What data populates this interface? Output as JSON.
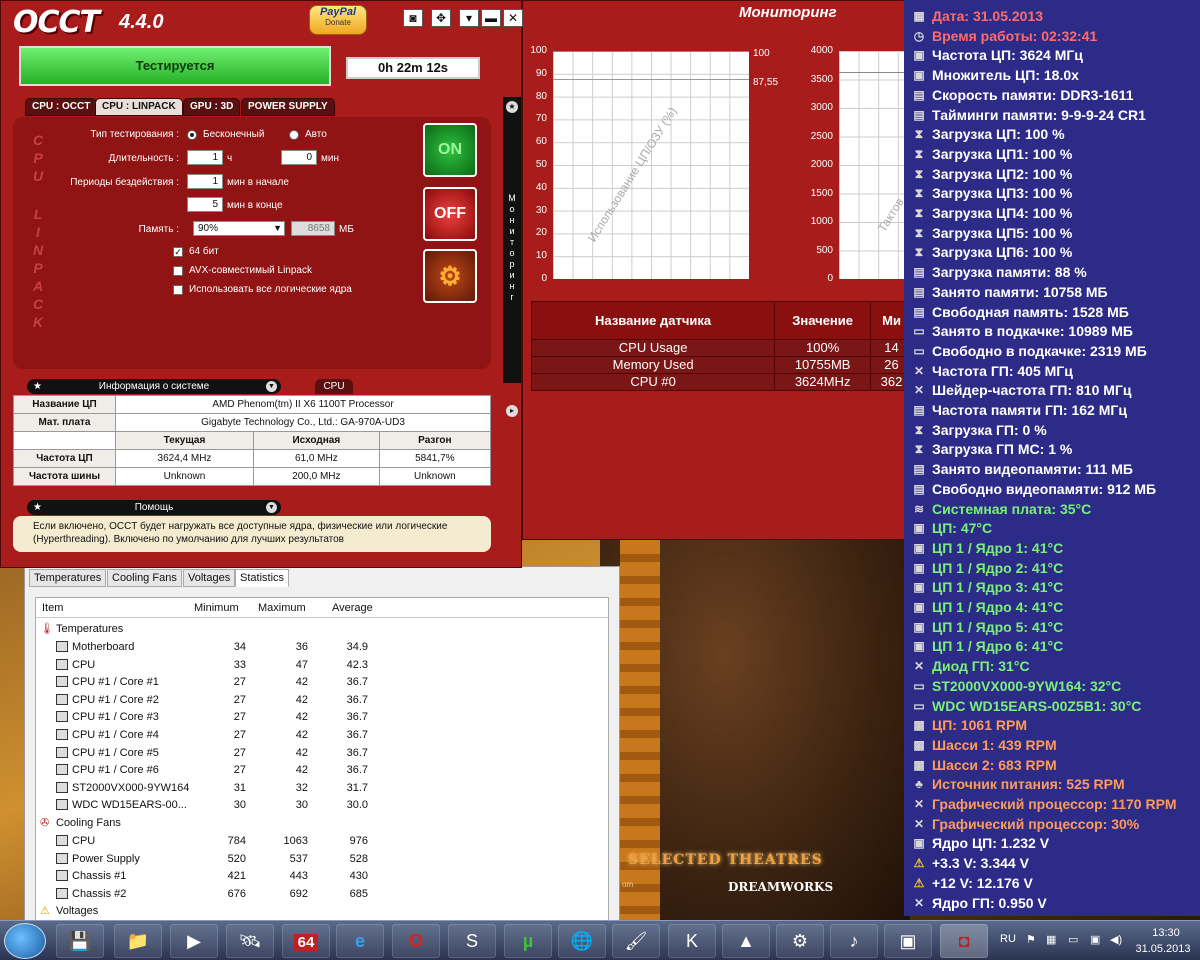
{
  "occt": {
    "logo": "OCCT",
    "version": "4.4.0",
    "paypal_label": "PayPal",
    "donate_label": "Donate",
    "status": "Тестируется",
    "timer": "0h 22m 12s",
    "tabs": [
      "CPU : OCCT",
      "CPU : LINPACK",
      "GPU : 3D",
      "POWER SUPPLY"
    ],
    "active_tab": 1,
    "vertical_label": "CPU LINPACK",
    "form": {
      "test_type_label": "Тип тестирования :",
      "test_type_infinite": "Бесконечный",
      "test_type_auto": "Авто",
      "duration_label": "Длительность :",
      "duration_hours": "1",
      "hours_unit": "ч",
      "duration_minutes": "0",
      "minutes_unit": "мин",
      "idle_label": "Периоды бездействия :",
      "idle_start": "1",
      "idle_start_unit": "мин в начале",
      "idle_end": "5",
      "idle_end_unit": "мин в конце",
      "memory_label": "Память :",
      "memory_value": "90%",
      "memory_mb": "8658",
      "memory_mb_unit": "МБ",
      "opt_64bit": "64 бит",
      "opt_avx": "AVX-совместимый Linpack",
      "opt_logical": "Использовать все логические ядра"
    },
    "on_label": "ON",
    "off_label": "OFF",
    "side_label": "Мониторинг",
    "sysinfo_header": "Информация о системе",
    "cpu_tab": "CPU",
    "sysinfo": {
      "cpu_name_label": "Название ЦП",
      "cpu_name": "AMD Phenom(tm) II X6 1100T Processor",
      "mobo_label": "Мат. плата",
      "mobo": "Gigabyte Technology Co., Ltd.: GA-970A-UD3",
      "col_current": "Текущая",
      "col_original": "Исходная",
      "col_overclock": "Разгон",
      "cpu_freq_label": "Частота ЦП",
      "cpu_freq_current": "3624,4 MHz",
      "cpu_freq_original": "61,0 MHz",
      "cpu_freq_overclock": "5841,7%",
      "bus_freq_label": "Частота шины",
      "bus_freq_current": "Unknown",
      "bus_freq_original": "200,0 MHz",
      "bus_freq_overclock": "Unknown"
    },
    "help_header": "Помощь",
    "help_text": "Если включено, OCCT будет нагружать все доступные ядра, физические или логические (Hyperthreading). Включено по умолчанию для лучших результатов"
  },
  "monitor": {
    "title": "Мониторинг",
    "chart1_label": "Использование ЦП/ОЗУ (%)",
    "chart1_ticks": [
      "100",
      "90",
      "80",
      "70",
      "60",
      "50",
      "40",
      "30",
      "20",
      "10",
      "0"
    ],
    "chart1_val_top": "100",
    "chart1_val_mid": "87,55",
    "chart2_label": "Тактов",
    "chart2_ticks": [
      "4000",
      "3500",
      "3000",
      "2500",
      "2000",
      "1500",
      "1000",
      "500",
      "0"
    ],
    "table_head": [
      "Название датчика",
      "Значение",
      "Ми"
    ],
    "rows": [
      {
        "name": "CPU Usage",
        "value": "100%",
        "min": "14"
      },
      {
        "name": "Memory Used",
        "value": "10755MB",
        "min": "26"
      },
      {
        "name": "CPU #0",
        "value": "3624MHz",
        "min": "362"
      }
    ]
  },
  "chart_data": [
    {
      "type": "line",
      "xlabel": "",
      "ylabel": "Использование ЦП/ОЗУ (%)",
      "ylim": [
        0,
        100
      ],
      "series": [
        {
          "name": "CPU Usage",
          "values": [
            100,
            100,
            100,
            100,
            100,
            100,
            100,
            100,
            100,
            100
          ]
        },
        {
          "name": "Memory Used",
          "values": [
            87.55,
            87.55,
            87.55,
            87.55,
            87.55,
            87.55,
            87.55,
            87.55,
            87.55,
            87.55
          ]
        }
      ]
    },
    {
      "type": "line",
      "xlabel": "",
      "ylabel": "Тактов",
      "ylim": [
        0,
        4000
      ],
      "series": [
        {
          "name": "CPU #0",
          "values": [
            3624,
            3624,
            3624,
            3624
          ]
        }
      ]
    }
  ],
  "stats": {
    "tabs": [
      "Temperatures",
      "Cooling Fans",
      "Voltages",
      "Statistics"
    ],
    "active_tab": 3,
    "headers": [
      "Item",
      "Minimum",
      "Maximum",
      "Average"
    ],
    "groups": [
      {
        "label": "Temperatures",
        "rows": [
          {
            "name": "Motherboard",
            "min": "34",
            "max": "36",
            "avg": "34.9"
          },
          {
            "name": "CPU",
            "min": "33",
            "max": "47",
            "avg": "42.3"
          },
          {
            "name": "CPU #1 / Core #1",
            "min": "27",
            "max": "42",
            "avg": "36.7"
          },
          {
            "name": "CPU #1 / Core #2",
            "min": "27",
            "max": "42",
            "avg": "36.7"
          },
          {
            "name": "CPU #1 / Core #3",
            "min": "27",
            "max": "42",
            "avg": "36.7"
          },
          {
            "name": "CPU #1 / Core #4",
            "min": "27",
            "max": "42",
            "avg": "36.7"
          },
          {
            "name": "CPU #1 / Core #5",
            "min": "27",
            "max": "42",
            "avg": "36.7"
          },
          {
            "name": "CPU #1 / Core #6",
            "min": "27",
            "max": "42",
            "avg": "36.7"
          },
          {
            "name": "ST2000VX000-9YW164",
            "min": "31",
            "max": "32",
            "avg": "31.7"
          },
          {
            "name": "WDC WD15EARS-00...",
            "min": "30",
            "max": "30",
            "avg": "30.0"
          }
        ]
      },
      {
        "label": "Cooling Fans",
        "rows": [
          {
            "name": "CPU",
            "min": "784",
            "max": "1063",
            "avg": "976"
          },
          {
            "name": "Power Supply",
            "min": "520",
            "max": "537",
            "avg": "528"
          },
          {
            "name": "Chassis #1",
            "min": "421",
            "max": "443",
            "avg": "430"
          },
          {
            "name": "Chassis #2",
            "min": "676",
            "max": "692",
            "avg": "685"
          }
        ]
      },
      {
        "label": "Voltages",
        "rows": []
      }
    ]
  },
  "overlay": [
    {
      "text": "Дата: 31.05.2013",
      "color": "#ff6a6a",
      "icon": "calendar-icon"
    },
    {
      "text": "Время работы: 02:32:41",
      "color": "#ff6a6a",
      "icon": "clock-icon"
    },
    {
      "text": "Частота ЦП: 3624 МГц",
      "color": "#ffffff",
      "icon": "cpu-icon"
    },
    {
      "text": "Множитель ЦП: 18.0x",
      "color": "#ffffff",
      "icon": "cpu-icon"
    },
    {
      "text": "Скорость памяти: DDR3-1611",
      "color": "#ffffff",
      "icon": "memory-icon"
    },
    {
      "text": "Тайминги памяти: 9-9-9-24 CR1",
      "color": "#ffffff",
      "icon": "memory-icon"
    },
    {
      "text": "Загрузка ЦП: 100 %",
      "color": "#ffffff",
      "icon": "hourglass-icon"
    },
    {
      "text": "Загрузка ЦП1: 100 %",
      "color": "#ffffff",
      "icon": "hourglass-icon"
    },
    {
      "text": "Загрузка ЦП2: 100 %",
      "color": "#ffffff",
      "icon": "hourglass-icon"
    },
    {
      "text": "Загрузка ЦП3: 100 %",
      "color": "#ffffff",
      "icon": "hourglass-icon"
    },
    {
      "text": "Загрузка ЦП4: 100 %",
      "color": "#ffffff",
      "icon": "hourglass-icon"
    },
    {
      "text": "Загрузка ЦП5: 100 %",
      "color": "#ffffff",
      "icon": "hourglass-icon"
    },
    {
      "text": "Загрузка ЦП6: 100 %",
      "color": "#ffffff",
      "icon": "hourglass-icon"
    },
    {
      "text": "Загрузка памяти: 88 %",
      "color": "#ffffff",
      "icon": "memory-icon"
    },
    {
      "text": "Занято памяти: 10758 МБ",
      "color": "#ffffff",
      "icon": "memory-icon"
    },
    {
      "text": "Свободная память: 1528 МБ",
      "color": "#ffffff",
      "icon": "memory-icon"
    },
    {
      "text": "Занято в подкачке: 10989 МБ",
      "color": "#ffffff",
      "icon": "disk-icon"
    },
    {
      "text": "Свободно в подкачке: 2319 МБ",
      "color": "#ffffff",
      "icon": "disk-icon"
    },
    {
      "text": "Частота ГП: 405 МГц",
      "color": "#ffffff",
      "icon": "gpu-icon"
    },
    {
      "text": "Шейдер-частота ГП: 810 МГц",
      "color": "#ffffff",
      "icon": "gpu-icon"
    },
    {
      "text": "Частота памяти ГП: 162 МГц",
      "color": "#ffffff",
      "icon": "memory-icon"
    },
    {
      "text": "Загрузка ГП: 0 %",
      "color": "#ffffff",
      "icon": "hourglass-icon"
    },
    {
      "text": "Загрузка ГП МС: 1 %",
      "color": "#ffffff",
      "icon": "hourglass-icon"
    },
    {
      "text": "Занято видеопамяти: 111 МБ",
      "color": "#ffffff",
      "icon": "memory-icon"
    },
    {
      "text": "Свободно видеопамяти: 912 МБ",
      "color": "#ffffff",
      "icon": "memory-icon"
    },
    {
      "text": "Системная плата: 35°C",
      "color": "#7af07a",
      "icon": "motherboard-icon"
    },
    {
      "text": "ЦП: 47°C",
      "color": "#7af07a",
      "icon": "cpu-icon"
    },
    {
      "text": "ЦП 1 / Ядро 1: 41°C",
      "color": "#7af07a",
      "icon": "cpu-icon"
    },
    {
      "text": "ЦП 1 / Ядро 2: 41°C",
      "color": "#7af07a",
      "icon": "cpu-icon"
    },
    {
      "text": "ЦП 1 / Ядро 3: 41°C",
      "color": "#7af07a",
      "icon": "cpu-icon"
    },
    {
      "text": "ЦП 1 / Ядро 4: 41°C",
      "color": "#7af07a",
      "icon": "cpu-icon"
    },
    {
      "text": "ЦП 1 / Ядро 5: 41°C",
      "color": "#7af07a",
      "icon": "cpu-icon"
    },
    {
      "text": "ЦП 1 / Ядро 6: 41°C",
      "color": "#7af07a",
      "icon": "cpu-icon"
    },
    {
      "text": "Диод ГП: 31°C",
      "color": "#7af07a",
      "icon": "gpu-icon"
    },
    {
      "text": "ST2000VX000-9YW164: 32°C",
      "color": "#7af07a",
      "icon": "disk-icon"
    },
    {
      "text": "WDC WD15EARS-00Z5B1: 30°C",
      "color": "#7af07a",
      "icon": "disk-icon"
    },
    {
      "text": "ЦП: 1061 RPM",
      "color": "#ff9a5a",
      "icon": "fan-icon"
    },
    {
      "text": "Шасси 1: 439 RPM",
      "color": "#ff9a5a",
      "icon": "fan-icon"
    },
    {
      "text": "Шасси 2: 683 RPM",
      "color": "#ff9a5a",
      "icon": "fan-icon"
    },
    {
      "text": "Источник питания: 525 RPM",
      "color": "#ff9a5a",
      "icon": "power-supply-icon"
    },
    {
      "text": "Графический процессор: 1170 RPM",
      "color": "#ff9a5a",
      "icon": "gpu-icon"
    },
    {
      "text": "Графический процессор: 30%",
      "color": "#ff9a5a",
      "icon": "gpu-icon"
    },
    {
      "text": "Ядро ЦП: 1.232 V",
      "color": "#ffffff",
      "icon": "cpu-icon"
    },
    {
      "text": "+3.3 V: 3.344 V",
      "color": "#ffffff",
      "icon": "warning-icon"
    },
    {
      "text": "+12 V: 12.176 V",
      "color": "#ffffff",
      "icon": "warning-icon"
    },
    {
      "text": "Ядро ГП: 0.950 V",
      "color": "#ffffff",
      "icon": "gpu-icon"
    }
  ],
  "wallpaper": {
    "text": "SELECTED THEATRES",
    "small": "om",
    "logo": "DREAMWORKS"
  },
  "taskbar": {
    "apps": [
      {
        "icon": "floppy-icon",
        "glyph": "💾"
      },
      {
        "icon": "folder-icon",
        "glyph": "📁"
      },
      {
        "icon": "media-player-icon",
        "glyph": "▶"
      },
      {
        "icon": "satellite-icon",
        "glyph": "🛰"
      },
      {
        "icon": "aida64-icon",
        "glyph": "64"
      },
      {
        "icon": "ie-icon",
        "glyph": "e"
      },
      {
        "icon": "opera-icon",
        "glyph": "O"
      },
      {
        "icon": "steam-icon",
        "glyph": "S"
      },
      {
        "icon": "utorrent-icon",
        "glyph": "µ"
      },
      {
        "icon": "globe-icon",
        "glyph": "🌐"
      },
      {
        "icon": "paint-icon",
        "glyph": "🖌"
      },
      {
        "icon": "kmplayer-icon",
        "glyph": "K"
      },
      {
        "icon": "daemon-icon",
        "glyph": "▲"
      },
      {
        "icon": "tool-icon",
        "glyph": "⚙"
      },
      {
        "icon": "audio-icon",
        "glyph": "♪"
      },
      {
        "icon": "hwmonitor-icon",
        "glyph": "▣"
      },
      {
        "icon": "occt-icon",
        "glyph": "◘"
      }
    ],
    "lang": "RU",
    "time": "13:30",
    "date": "31.05.2013"
  }
}
